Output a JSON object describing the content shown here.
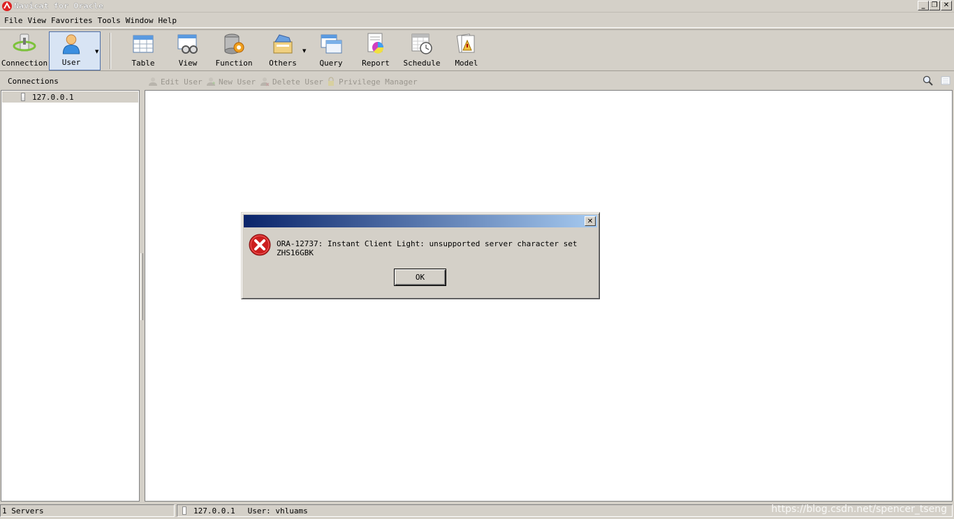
{
  "window": {
    "title": "Navicat for Oracle"
  },
  "menu": [
    "File",
    "View",
    "Favorites",
    "Tools",
    "Window",
    "Help"
  ],
  "toolbar": {
    "connection": "Connection",
    "user": "User",
    "table": "Table",
    "view": "View",
    "function": "Function",
    "others": "Others",
    "query": "Query",
    "report": "Report",
    "schedule": "Schedule",
    "model": "Model"
  },
  "subbar": {
    "connections": "Connections",
    "edit_user": "Edit User",
    "new_user": "New User",
    "delete_user": "Delete User",
    "privilege_manager": "Privilege Manager"
  },
  "tree": {
    "server": "127.0.0.1"
  },
  "status": {
    "servers": "1 Servers",
    "host": "127.0.0.1",
    "user": "User: vhluams"
  },
  "watermark": "https://blog.csdn.net/spencer_tseng",
  "dialog": {
    "message": "ORA-12737: Instant Client Light: unsupported server character set ZHS16GBK",
    "ok": "OK"
  },
  "colors": {
    "dialog_title_start": "#0a246a",
    "dialog_title_end": "#a6caf0",
    "error_icon": "#cc1e1e"
  },
  "icons": [
    "connection-icon",
    "user-icon",
    "table-icon",
    "view-icon",
    "function-icon",
    "others-icon",
    "query-icon",
    "report-icon",
    "schedule-icon",
    "model-icon",
    "error-icon",
    "search-icon"
  ]
}
